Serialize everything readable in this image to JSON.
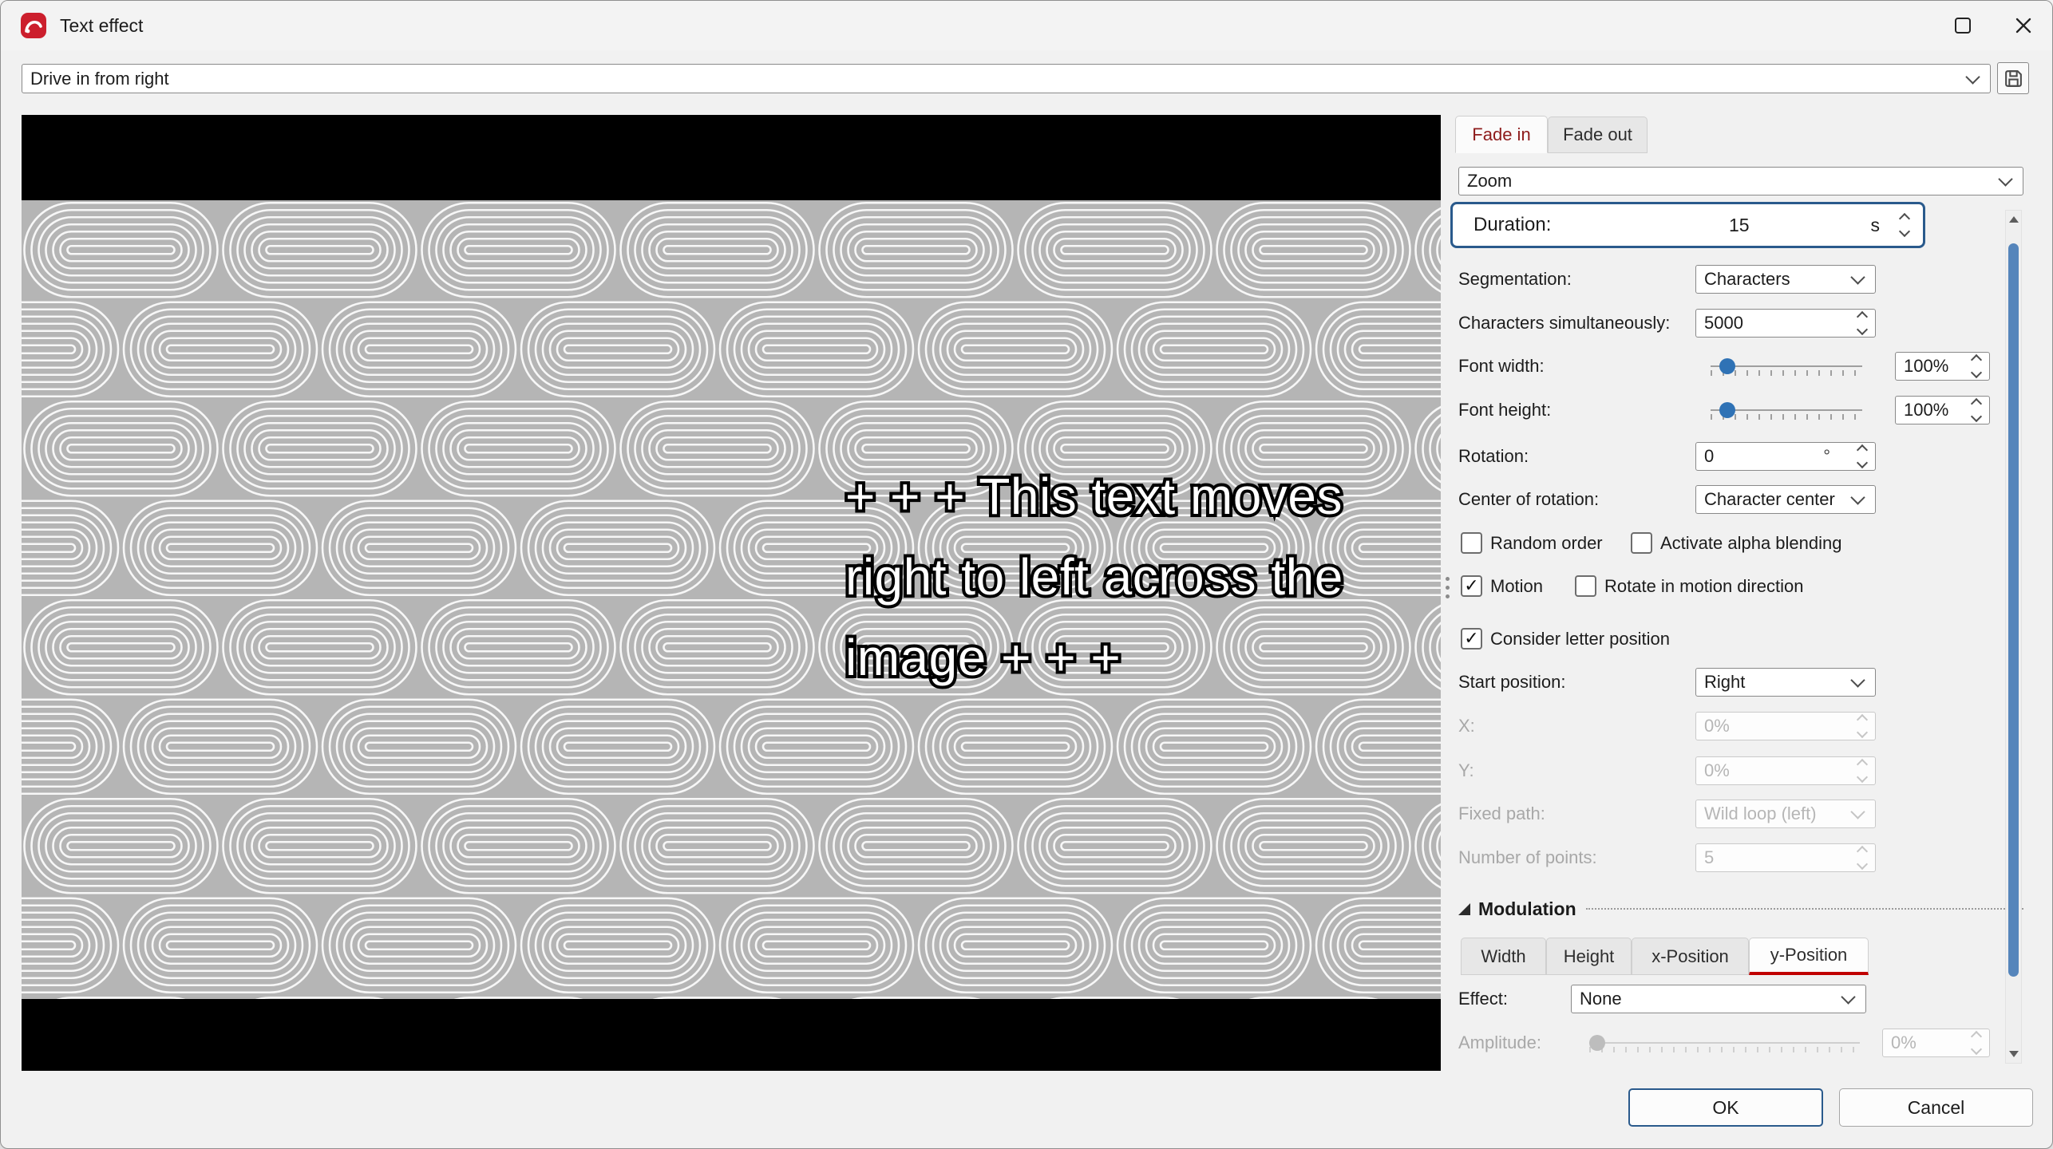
{
  "window": {
    "title": "Text effect"
  },
  "preset": {
    "value": "Drive in from right"
  },
  "preview": {
    "line1": "+ + + This text moves",
    "line2": "right to left across the",
    "line3": "image + + +"
  },
  "tabs": {
    "fade_in": "Fade in",
    "fade_out": "Fade out"
  },
  "animation": {
    "value": "Zoom"
  },
  "duration": {
    "label": "Duration:",
    "value": "15",
    "unit": "s"
  },
  "segmentation": {
    "label": "Segmentation:",
    "value": "Characters"
  },
  "chars_simultaneously": {
    "label": "Characters simultaneously:",
    "value": "5000"
  },
  "font_width": {
    "label": "Font width:",
    "value": "100%"
  },
  "font_height": {
    "label": "Font height:",
    "value": "100%"
  },
  "rotation": {
    "label": "Rotation:",
    "value": "0",
    "unit": "°"
  },
  "center_of_rotation": {
    "label": "Center of rotation:",
    "value": "Character center"
  },
  "checkboxes": {
    "random_order": {
      "label": "Random order",
      "checked": false
    },
    "alpha_blending": {
      "label": "Activate alpha blending",
      "checked": false
    },
    "motion": {
      "label": "Motion",
      "checked": true
    },
    "rotate_motion": {
      "label": "Rotate in motion direction",
      "checked": false
    },
    "consider_letter": {
      "label": "Consider letter position",
      "checked": true
    }
  },
  "start_position": {
    "label": "Start position:",
    "value": "Right"
  },
  "pos_x": {
    "label": "X:",
    "value": "0%"
  },
  "pos_y": {
    "label": "Y:",
    "value": "0%"
  },
  "fixed_path": {
    "label": "Fixed path:",
    "value": "Wild loop (left)"
  },
  "number_of_points": {
    "label": "Number of points:",
    "value": "5"
  },
  "modulation": {
    "title": "Modulation",
    "tabs": [
      "Width",
      "Height",
      "x-Position",
      "y-Position"
    ],
    "active_tab": "y-Position",
    "effect": {
      "label": "Effect:",
      "value": "None"
    },
    "amplitude": {
      "label": "Amplitude:",
      "value": "0%"
    }
  },
  "buttons": {
    "ok": "OK",
    "cancel": "Cancel"
  },
  "glyphs": {
    "check": "✓"
  },
  "colors": {
    "accent_red": "#c00000",
    "focus_blue": "#2a5a8c",
    "slider_blue": "#2f72b5",
    "scroll_thumb": "#5585bb"
  }
}
